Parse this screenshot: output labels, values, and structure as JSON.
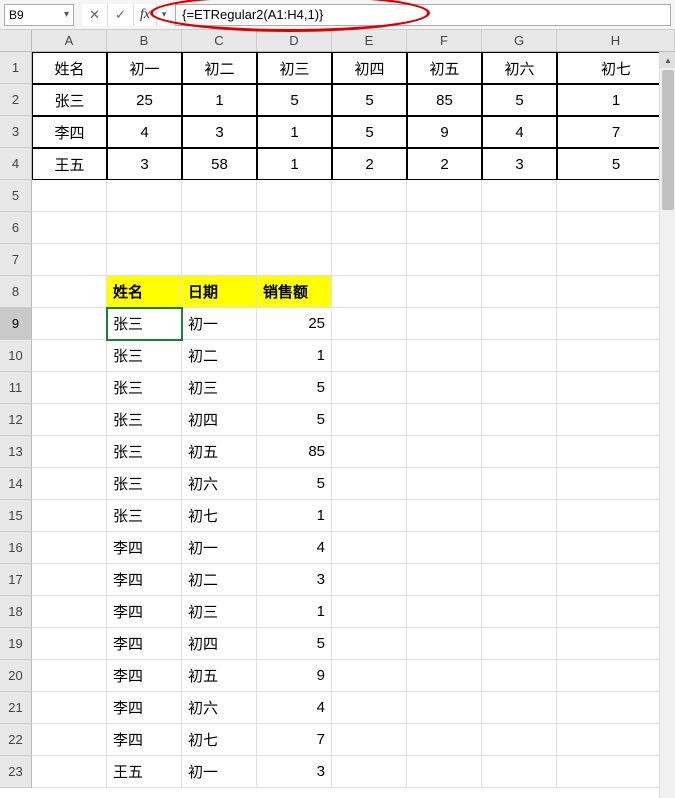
{
  "nameBox": "B9",
  "formula": "{=ETRegular2(A1:H4,1)}",
  "columns": [
    "A",
    "B",
    "C",
    "D",
    "E",
    "F",
    "G",
    "H"
  ],
  "rows": [
    "1",
    "2",
    "3",
    "4",
    "5",
    "6",
    "7",
    "8",
    "9",
    "10",
    "11",
    "12",
    "13",
    "14",
    "15",
    "16",
    "17",
    "18",
    "19",
    "20",
    "21",
    "22",
    "23"
  ],
  "activeRow": "9",
  "topTable": {
    "headers": [
      "姓名",
      "初一",
      "初二",
      "初三",
      "初四",
      "初五",
      "初六",
      "初七"
    ],
    "rows": [
      [
        "张三",
        "25",
        "1",
        "5",
        "5",
        "85",
        "5",
        "1"
      ],
      [
        "李四",
        "4",
        "3",
        "1",
        "5",
        "9",
        "4",
        "7"
      ],
      [
        "王五",
        "3",
        "58",
        "1",
        "2",
        "2",
        "3",
        "5"
      ]
    ]
  },
  "yellowHeaders": [
    "姓名",
    "日期",
    "销售额"
  ],
  "listData": [
    {
      "name": "张三",
      "date": "初一",
      "val": "25"
    },
    {
      "name": "张三",
      "date": "初二",
      "val": "1"
    },
    {
      "name": "张三",
      "date": "初三",
      "val": "5"
    },
    {
      "name": "张三",
      "date": "初四",
      "val": "5"
    },
    {
      "name": "张三",
      "date": "初五",
      "val": "85"
    },
    {
      "name": "张三",
      "date": "初六",
      "val": "5"
    },
    {
      "name": "张三",
      "date": "初七",
      "val": "1"
    },
    {
      "name": "李四",
      "date": "初一",
      "val": "4"
    },
    {
      "name": "李四",
      "date": "初二",
      "val": "3"
    },
    {
      "name": "李四",
      "date": "初三",
      "val": "1"
    },
    {
      "name": "李四",
      "date": "初四",
      "val": "5"
    },
    {
      "name": "李四",
      "date": "初五",
      "val": "9"
    },
    {
      "name": "李四",
      "date": "初六",
      "val": "4"
    },
    {
      "name": "李四",
      "date": "初七",
      "val": "7"
    },
    {
      "name": "王五",
      "date": "初一",
      "val": "3"
    }
  ]
}
